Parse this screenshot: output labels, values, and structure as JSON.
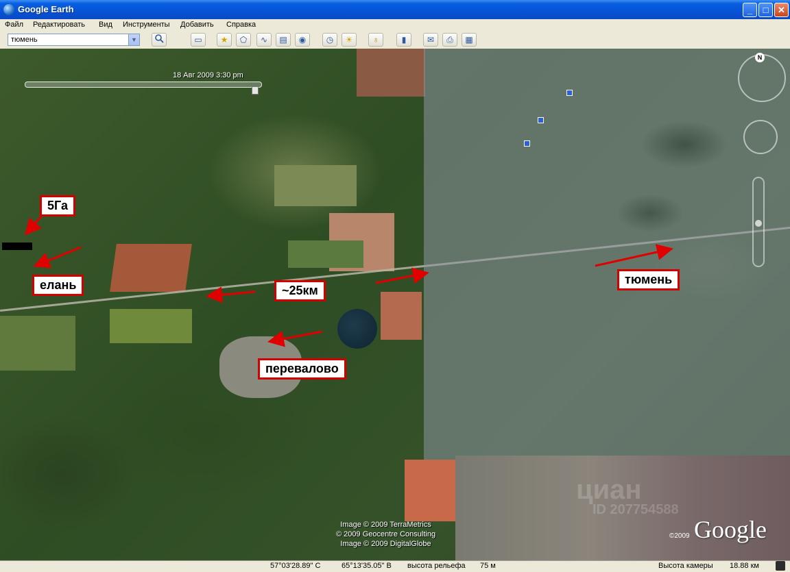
{
  "window": {
    "title": "Google Earth"
  },
  "menu": [
    "Файл",
    "Редактировать",
    "Вид",
    "Инструменты",
    "Добавить",
    "Справка"
  ],
  "search": {
    "value": "тюмень"
  },
  "time": {
    "label": "18 Авг 2009   3:30 pm"
  },
  "labels": {
    "five_ga": "5Га",
    "elan": "елань",
    "distance": "~25км",
    "perevalovo": "перевалово",
    "tyumen": "тюмень"
  },
  "nav": {
    "north": "N"
  },
  "attribution": {
    "line1": "Image © 2009 TerraMetrics",
    "line2": "© 2009 Geocentre Consulting",
    "line3": "Image © 2009 DigitalGlobe",
    "year": "©2009",
    "logo": "Google"
  },
  "watermark": {
    "brand": "циан",
    "id": "ID 207754588"
  },
  "status": {
    "lat": "57°03'28.89\" С",
    "lon": "65°13'35.05\" В",
    "elevation_label": "высота рельефа",
    "elevation": "75 м",
    "camera_label": "Высота камеры",
    "camera": "18.88 км"
  }
}
